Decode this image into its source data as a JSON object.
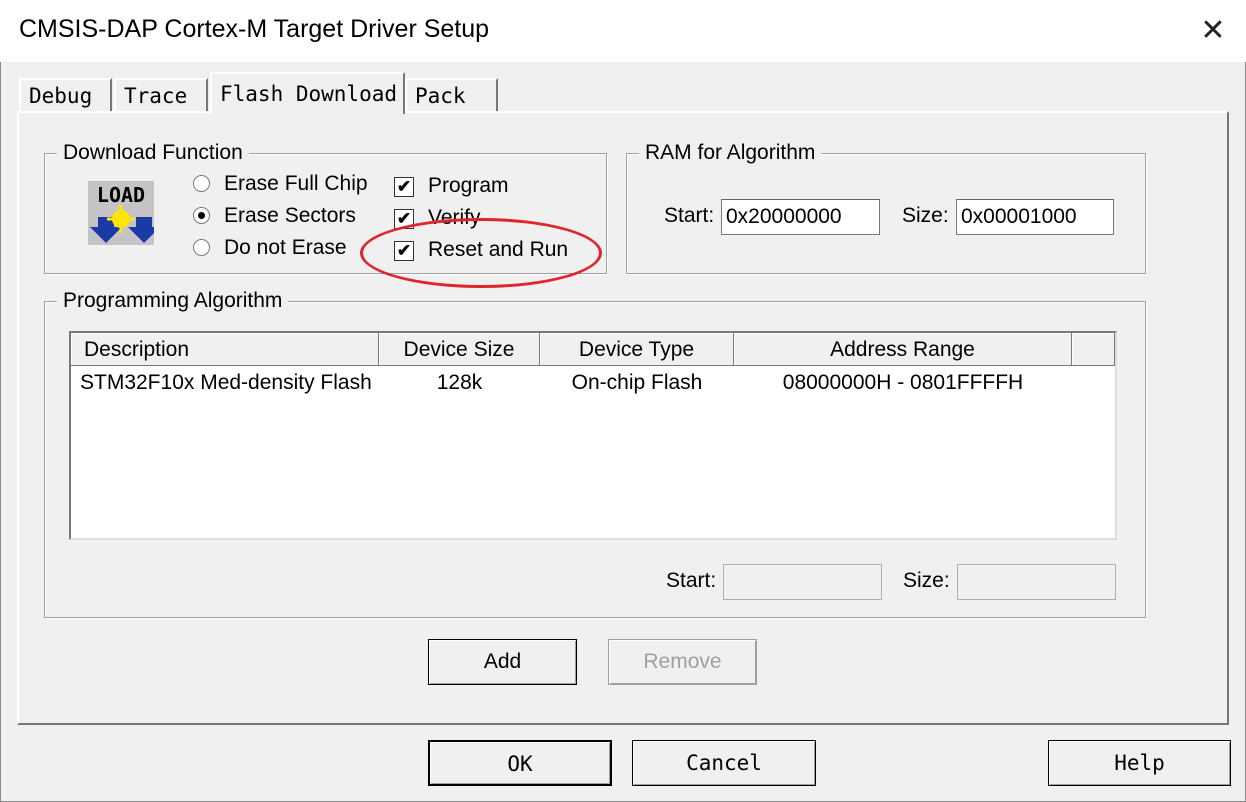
{
  "window": {
    "title": "CMSIS-DAP Cortex-M Target Driver Setup",
    "close_symbol": "✕"
  },
  "tabs": [
    {
      "label": "Debug"
    },
    {
      "label": "Trace"
    },
    {
      "label": "Flash Download"
    },
    {
      "label": "Pack"
    }
  ],
  "download_function": {
    "label": "Download Function",
    "icon_text": "LOAD",
    "radios": [
      {
        "label": "Erase Full Chip",
        "selected": false
      },
      {
        "label": "Erase Sectors",
        "selected": true
      },
      {
        "label": "Do not Erase",
        "selected": false
      }
    ],
    "checks": [
      {
        "label": "Program",
        "checked": true
      },
      {
        "label": "Verify",
        "checked": true
      },
      {
        "label": "Reset and Run",
        "checked": true
      }
    ]
  },
  "ram": {
    "label": "RAM for Algorithm",
    "start_label": "Start:",
    "start_value": "0x20000000",
    "size_label": "Size:",
    "size_value": "0x00001000"
  },
  "programming": {
    "label": "Programming Algorithm",
    "columns": [
      "Description",
      "Device Size",
      "Device Type",
      "Address Range"
    ],
    "rows": [
      [
        "STM32F10x Med-density Flash",
        "128k",
        "On-chip Flash",
        "08000000H - 0801FFFFH"
      ]
    ],
    "start_label": "Start:",
    "start_value": "",
    "size_label": "Size:",
    "size_value": ""
  },
  "panel_buttons": {
    "add": "Add",
    "remove": "Remove"
  },
  "dialog_buttons": {
    "ok": "OK",
    "cancel": "Cancel",
    "help": "Help"
  },
  "annotation_color": "#e0262c"
}
